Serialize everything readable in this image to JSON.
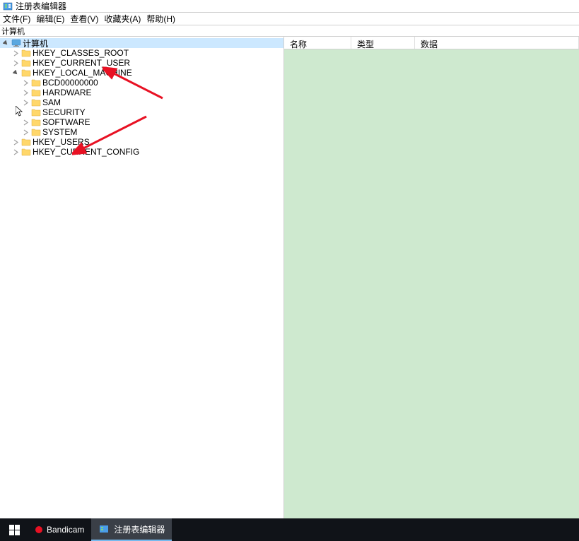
{
  "titlebar": {
    "title": "注册表编辑器"
  },
  "menubar": {
    "file": "文件(F)",
    "edit": "编辑(E)",
    "view": "查看(V)",
    "favorites": "收藏夹(A)",
    "help": "帮助(H)"
  },
  "addressbar": {
    "path": "计算机"
  },
  "tree": {
    "root": "计算机",
    "items": [
      {
        "label": "HKEY_CLASSES_ROOT",
        "expanded": false,
        "indent": 1
      },
      {
        "label": "HKEY_CURRENT_USER",
        "expanded": false,
        "indent": 1
      },
      {
        "label": "HKEY_LOCAL_MACHINE",
        "expanded": true,
        "indent": 1
      },
      {
        "label": "BCD00000000",
        "expanded": false,
        "indent": 2
      },
      {
        "label": "HARDWARE",
        "expanded": false,
        "indent": 2
      },
      {
        "label": "SAM",
        "expanded": false,
        "indent": 2
      },
      {
        "label": "SECURITY",
        "expanded": false,
        "indent": 2,
        "noexpand": true
      },
      {
        "label": "SOFTWARE",
        "expanded": false,
        "indent": 2
      },
      {
        "label": "SYSTEM",
        "expanded": false,
        "indent": 2
      },
      {
        "label": "HKEY_USERS",
        "expanded": false,
        "indent": 1
      },
      {
        "label": "HKEY_CURRENT_CONFIG",
        "expanded": false,
        "indent": 1
      }
    ]
  },
  "list": {
    "columns": {
      "name": "名称",
      "type": "类型",
      "data": "数据"
    }
  },
  "taskbar": {
    "bandicam": "Bandicam",
    "regedit": "注册表编辑器"
  }
}
